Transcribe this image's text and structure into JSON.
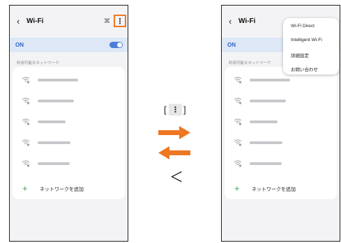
{
  "left": {
    "title": "Wi-Fi",
    "on_label": "ON",
    "section_label": "利用可能なネットワーク",
    "add_network": "ネットワークを追加"
  },
  "right": {
    "title": "Wi-Fi",
    "on_label": "ON",
    "section_label": "利用可能なネットワーク",
    "add_network": "ネットワークを追加",
    "menu": [
      "Wi-Fi Direct",
      "Intelligent Wi-Fi",
      "詳細設定",
      "お問い合わせ"
    ]
  },
  "icons": {
    "back": "‹",
    "more": "⋮",
    "scan": "⌘",
    "plus": "+",
    "lt": "＜"
  },
  "labels": {
    "bracket_open": "[",
    "bracket_close": "]"
  },
  "colors": {
    "accent_orange": "#ee7722",
    "on_blue": "#2f64c5",
    "plus_green": "#3aa05a"
  }
}
